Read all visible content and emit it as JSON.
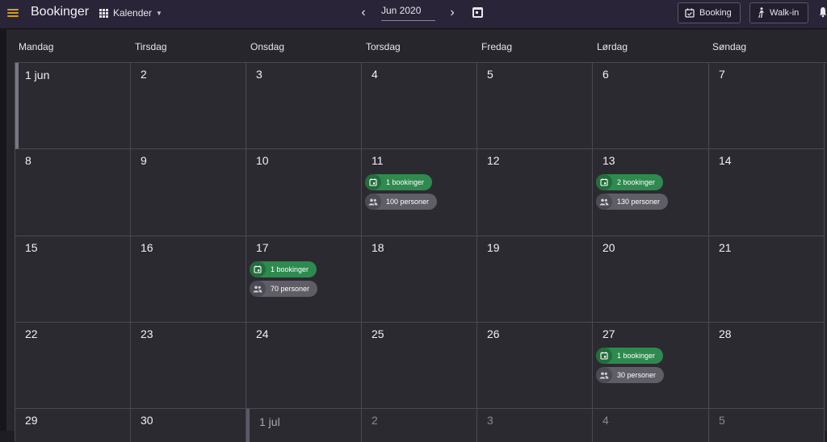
{
  "header": {
    "title": "Bookinger",
    "view_label": "Kalender",
    "month_value": "Jun 2020",
    "booking_button": "Booking",
    "walkin_button": "Walk-in"
  },
  "weekdays": [
    "Mandag",
    "Tirsdag",
    "Onsdag",
    "Torsdag",
    "Fredag",
    "Lørdag",
    "Søndag"
  ],
  "weeks": [
    [
      "1 jun",
      "2",
      "3",
      "4",
      "5",
      "6",
      "7"
    ],
    [
      "8",
      "9",
      "10",
      "11",
      "12",
      "13",
      "14"
    ],
    [
      "15",
      "16",
      "17",
      "18",
      "19",
      "20",
      "21"
    ],
    [
      "22",
      "23",
      "24",
      "25",
      "26",
      "27",
      "28"
    ],
    [
      "29",
      "30",
      "1 jul",
      "2",
      "3",
      "4",
      "5"
    ]
  ],
  "events": {
    "week2_thu": {
      "bookings": "1 bookinger",
      "persons": "100 personer"
    },
    "week2_sat": {
      "bookings": "2 bookinger",
      "persons": "130 personer"
    },
    "week3_wed": {
      "bookings": "1 bookinger",
      "persons": "70 personer"
    },
    "week4_sat": {
      "bookings": "1 bookinger",
      "persons": "30 personer"
    }
  },
  "colors": {
    "topbar": "#2a2438",
    "menu_accent": "#d4a017",
    "booking_chip": "#2e8a4f",
    "persons_chip": "#5f5d66"
  }
}
